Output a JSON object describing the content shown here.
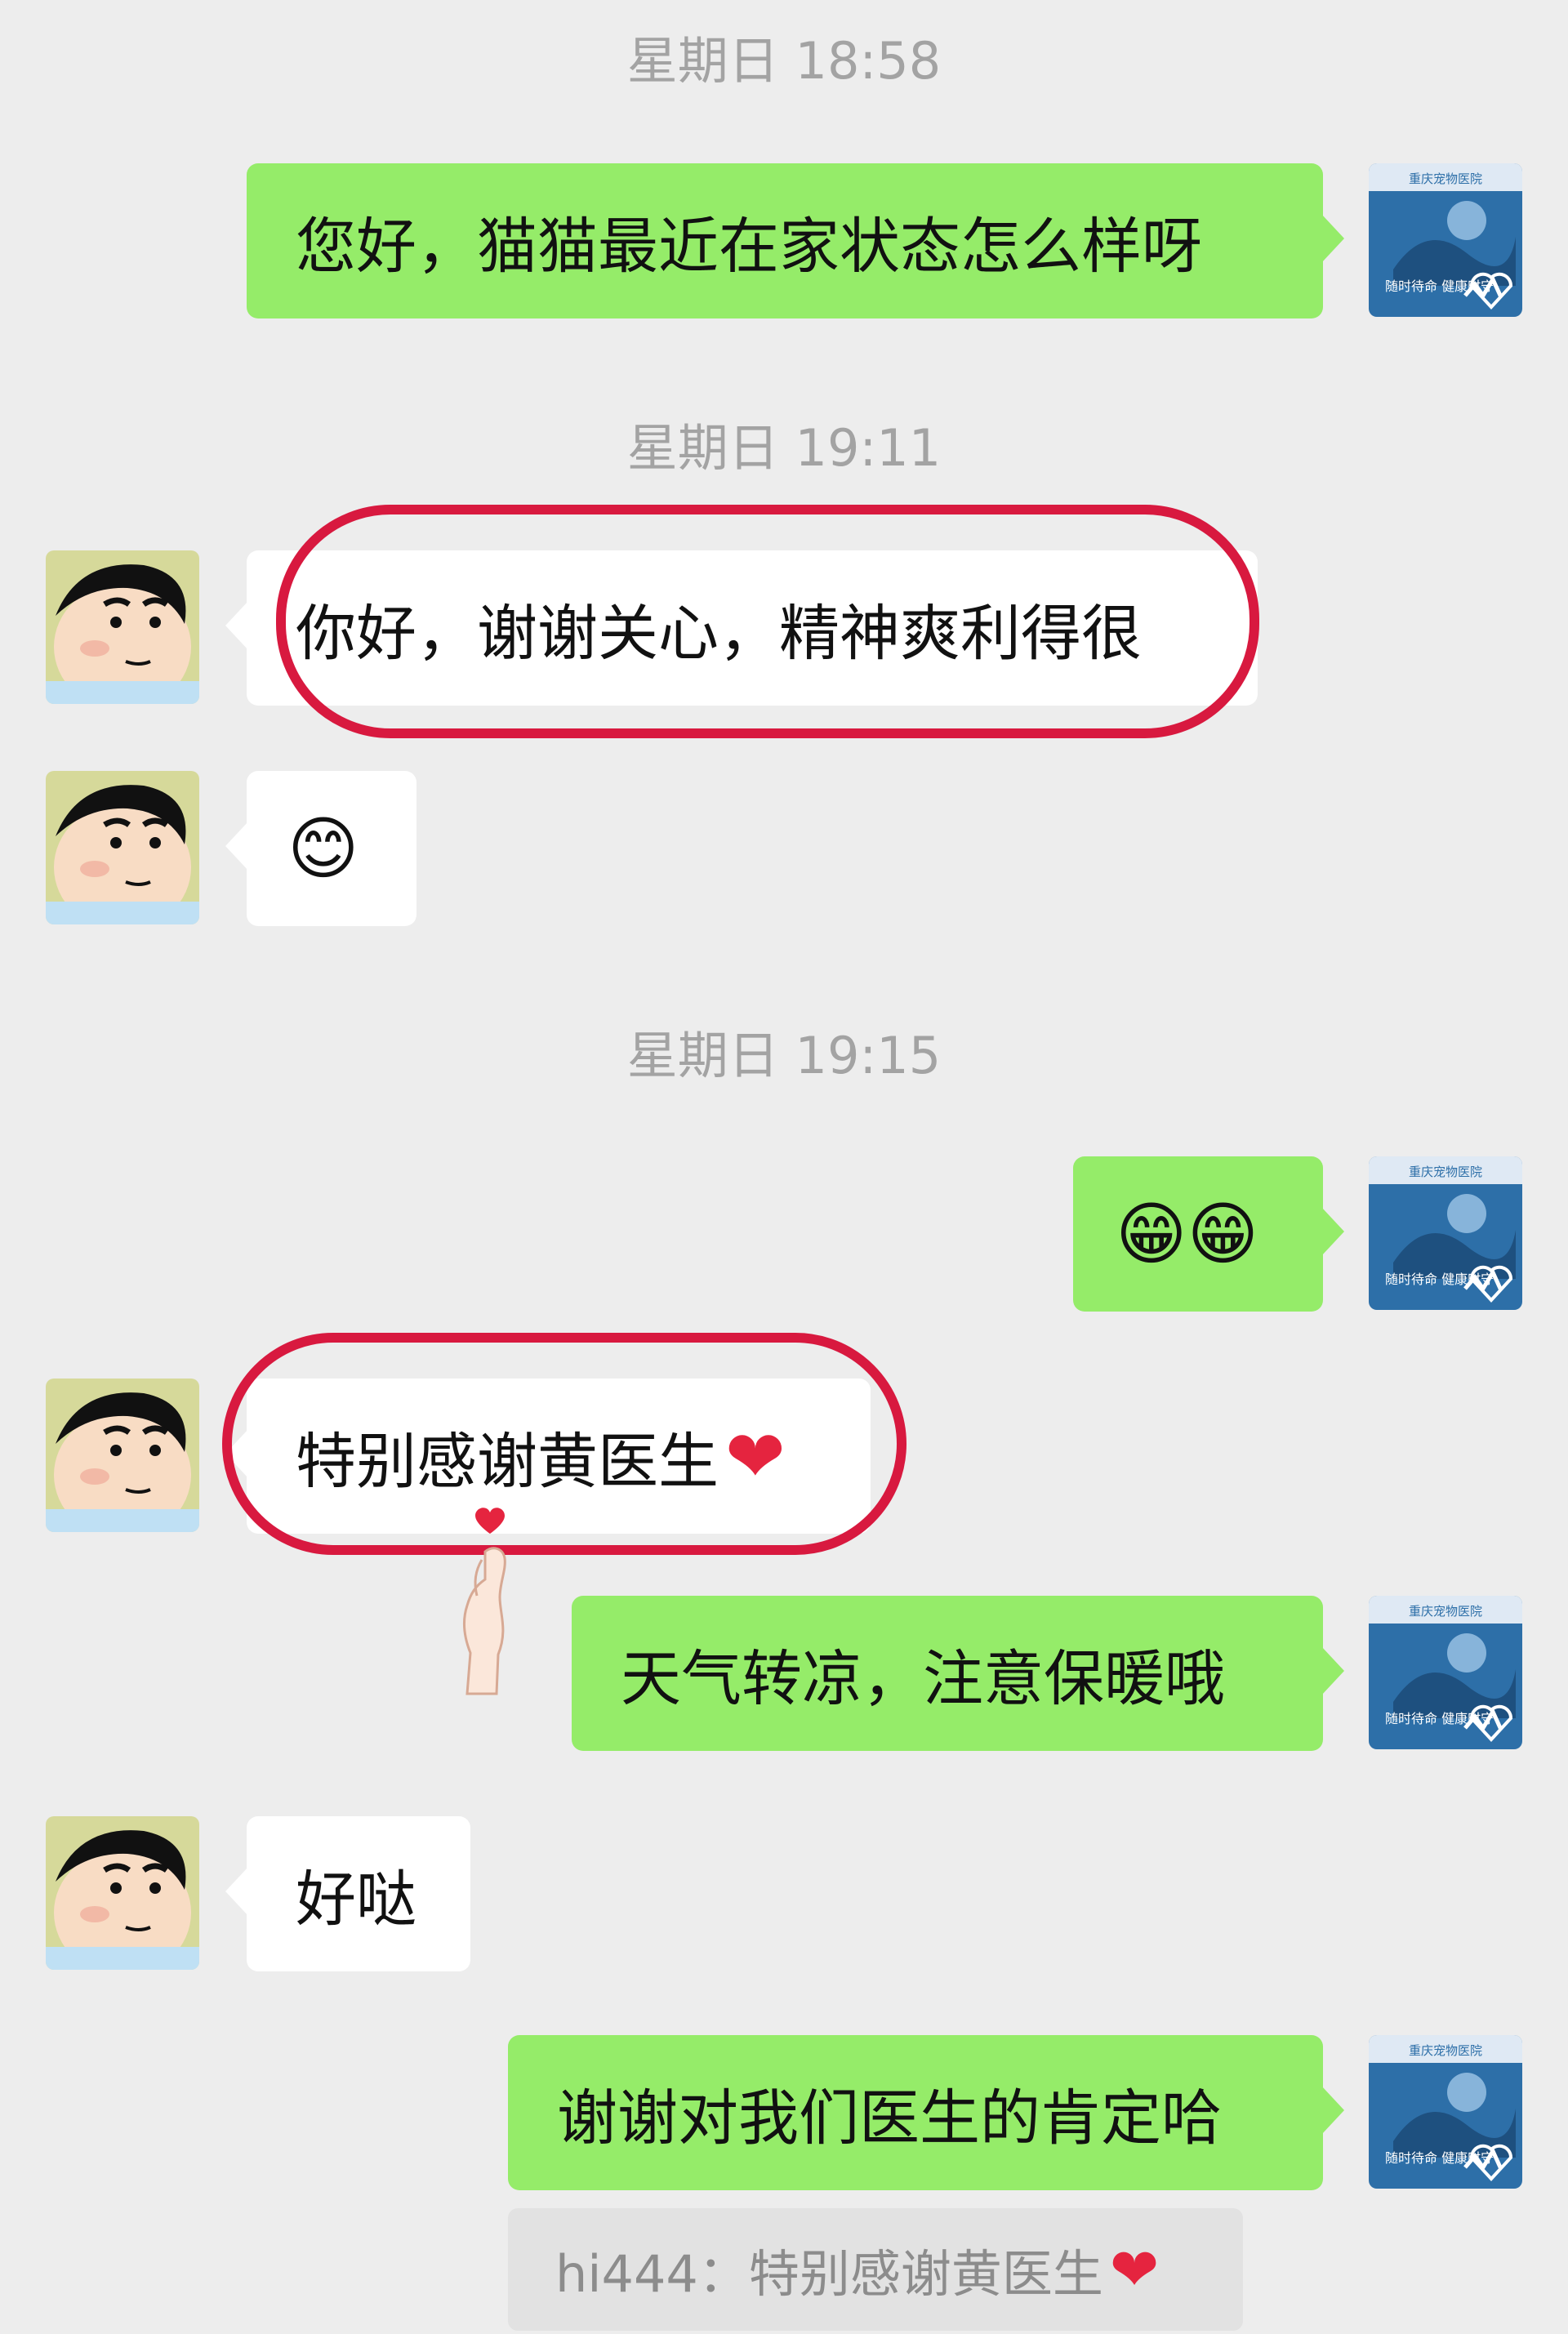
{
  "timestamps": [
    "星期日 18:58",
    "星期日 19:11",
    "星期日 19:15"
  ],
  "messages": [
    {
      "side": "outgoing",
      "text": "您好，猫猫最近在家状态怎么样呀"
    },
    {
      "side": "incoming",
      "text": "你好，谢谢关心，精神爽利得很",
      "highlighted": true
    },
    {
      "side": "incoming",
      "text": "😊"
    },
    {
      "side": "outgoing",
      "text": "😁😁"
    },
    {
      "side": "incoming",
      "text": "特别感谢黄医生",
      "suffix": "❤",
      "highlighted": true
    },
    {
      "side": "outgoing",
      "text": "天气转凉，注意保暖哦"
    },
    {
      "side": "incoming",
      "text": "好哒"
    },
    {
      "side": "outgoing",
      "text": "谢谢对我们医生的肯定哈"
    }
  ],
  "quote": {
    "text": "hi444：特别感谢黄医生",
    "suffix": "❤"
  },
  "avatars": {
    "outgoing": {
      "name": "clinic-avatar",
      "caption_top": "重庆宠物医院",
      "caption_bottom": "随时待命 健康时守"
    },
    "incoming": {
      "name": "crayon-shinchan-avatar"
    }
  },
  "colors": {
    "background": "#ededed",
    "outgoing_bubble": "#95ec69",
    "incoming_bubble": "#ffffff",
    "highlight": "#d8193f",
    "timestamp": "#a3a3a3",
    "quote_bg": "#e2e2e2"
  },
  "stickers": [
    {
      "name": "finger-heart-sticker"
    }
  ]
}
